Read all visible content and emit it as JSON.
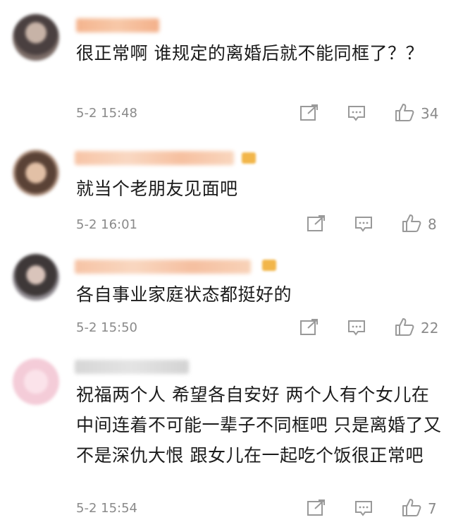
{
  "comments": [
    {
      "text": "很正常啊 谁规定的离婚后就不能同框了？？",
      "time": "5-2 15:48",
      "likes": "34"
    },
    {
      "text": "就当个老朋友见面吧",
      "time": "5-2 16:01",
      "likes": "8"
    },
    {
      "text": "各自事业家庭状态都挺好的",
      "time": "5-2 15:50",
      "likes": "22"
    },
    {
      "text": "祝福两个人 希望各自安好 两个人有个女儿在中间连着不可能一辈子不同框吧 只是离婚了又不是深仇大恨 跟女儿在一起吃个饭很正常吧",
      "time": "5-2 15:54",
      "likes": "7"
    }
  ],
  "icons": {
    "share": "share-icon",
    "reply": "comment-icon",
    "like": "thumbs-up-icon"
  },
  "colors": {
    "text": "#1b1b1b",
    "meta": "#8a8a8a",
    "badge": "#f2b64a"
  }
}
